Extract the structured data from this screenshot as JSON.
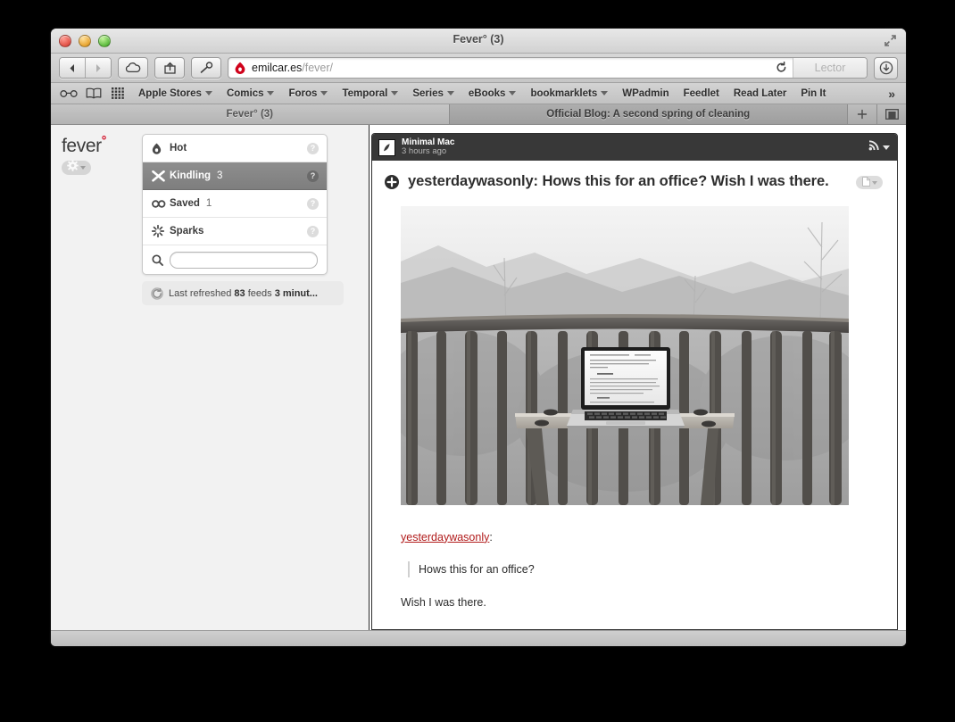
{
  "window": {
    "title": "Fever° (3)",
    "traffic": [
      "close",
      "minimize",
      "zoom"
    ]
  },
  "toolbar": {
    "back_label": "◀",
    "forward_label": "▶",
    "icloud_tabs_label": "icloud-tabs",
    "share_label": "share",
    "onepassword_label": "1password",
    "url_host": "emilcar.es",
    "url_path": "/fever/",
    "reload_label": "⟳",
    "reader_label": "Lector",
    "downloads_label": "downloads"
  },
  "bookmarks": {
    "icons": [
      "glasses-icon",
      "book-icon",
      "grid-icon"
    ],
    "items": [
      {
        "label": "Apple Stores",
        "has_menu": true
      },
      {
        "label": "Comics",
        "has_menu": true
      },
      {
        "label": "Foros",
        "has_menu": true
      },
      {
        "label": "Temporal",
        "has_menu": true
      },
      {
        "label": "Series",
        "has_menu": true
      },
      {
        "label": "eBooks",
        "has_menu": true
      },
      {
        "label": "bookmarklets",
        "has_menu": true
      },
      {
        "label": "WPadmin",
        "has_menu": false
      },
      {
        "label": "Feedlet",
        "has_menu": false
      },
      {
        "label": "Read Later",
        "has_menu": false
      },
      {
        "label": "Pin It",
        "has_menu": false
      }
    ],
    "overflow_label": "»"
  },
  "tabs": [
    {
      "label": "Fever° (3)",
      "active": false
    },
    {
      "label": "Official Blog: A second spring of cleaning",
      "active": true
    }
  ],
  "tab_controls": {
    "new_tab_label": "+",
    "tab_overview_label": "▣"
  },
  "fever": {
    "logo_text": "fever",
    "logo_degree": "°",
    "settings_label": "settings",
    "feeds": [
      {
        "label": "Hot",
        "count": "",
        "icon": "flame-icon",
        "selected": false,
        "help": "?"
      },
      {
        "label": "Kindling",
        "count": "3",
        "icon": "kindling-icon",
        "selected": true,
        "help": "?"
      },
      {
        "label": "Saved",
        "count": "1",
        "icon": "links-icon",
        "selected": false,
        "help": "?"
      },
      {
        "label": "Sparks",
        "count": "",
        "icon": "sparks-icon",
        "selected": false,
        "help": "?"
      }
    ],
    "search_placeholder": "",
    "search_value": "",
    "refresh_prefix": "Last refreshed",
    "refresh_feeds": "83",
    "refresh_feeds_word": "feeds",
    "refresh_time": "3 minut...",
    "refresh_full": "Last refreshed 83 feeds 3 minut..."
  },
  "article": {
    "source_name": "Minimal Mac",
    "source_time": "3 hours ago",
    "rss_label": "rss-subscribe",
    "title": "yesterdaywasonly: Hows this for an office? Wish I was there.",
    "add_label": "add",
    "doc_label": "view-options",
    "photo_alt": "Black and white photo of a laptop on a wooden shelf on a cabin balcony railing with mountains behind",
    "link_text": "yesterdaywasonly",
    "link_suffix": ":",
    "quote": "Hows this for an office?",
    "paragraph": "Wish I was there."
  },
  "colors": {
    "accent_red": "#d0021b",
    "link_red": "#b11b1b",
    "selected_gray": "#8e8e8e",
    "header_dark": "#383838"
  }
}
